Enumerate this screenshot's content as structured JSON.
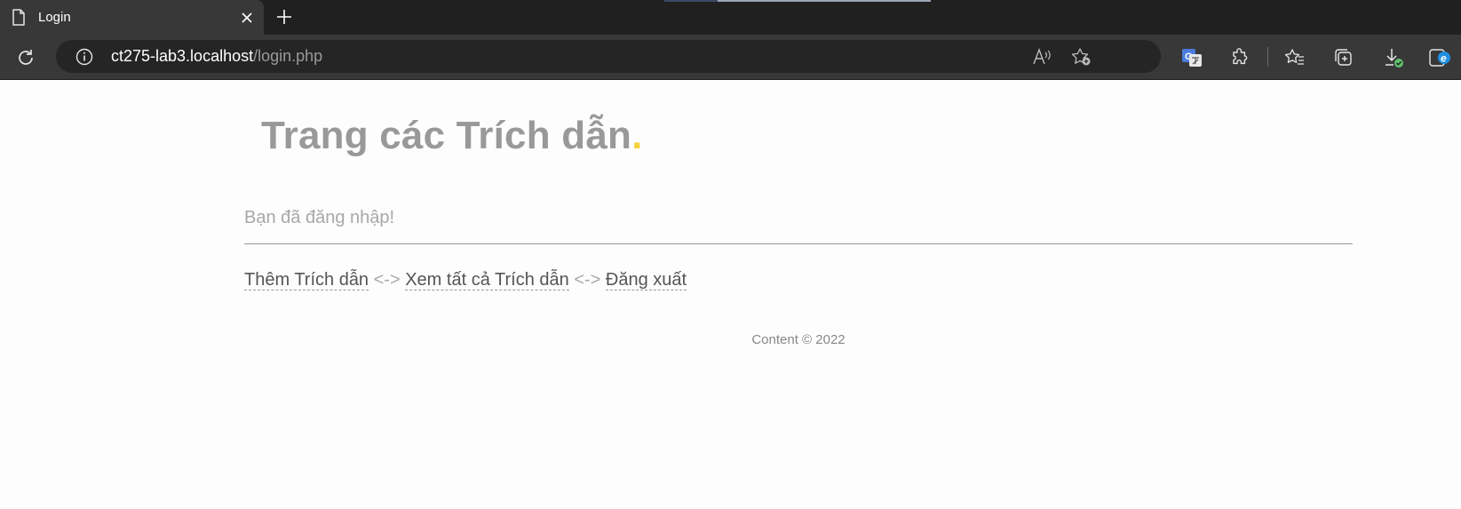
{
  "browser": {
    "tab": {
      "title": "Login"
    },
    "address": {
      "host": "ct275-lab3.localhost",
      "path": "/login.php"
    }
  },
  "page": {
    "title_text": "Trang các Trích dẫn",
    "title_dot": ".",
    "status": "Bạn đã đăng nhập!",
    "nav": {
      "add_quote": "Thêm Trích dẫn",
      "separator": "<->",
      "view_all": "Xem tất cả Trích dẫn",
      "logout": "Đăng xuất"
    },
    "footer": "Content © 2022"
  },
  "icons": {
    "tab_page": "page-icon",
    "tab_close": "close-icon",
    "new_tab": "plus-icon",
    "reload": "reload-icon",
    "site_info": "info-icon",
    "read_aloud": "read-aloud-icon",
    "add_favorite": "add-favorite-icon",
    "translate": "translate-icon",
    "extensions": "extensions-icon",
    "favorites": "favorites-icon",
    "collections": "collections-icon",
    "downloads": "downloads-icon",
    "edge": "edge-icon"
  },
  "colors": {
    "title": "#999999",
    "title_dot": "#f3d23a",
    "link": "#555555",
    "chrome_bg": "#202020",
    "toolbar_bg": "#383838"
  }
}
